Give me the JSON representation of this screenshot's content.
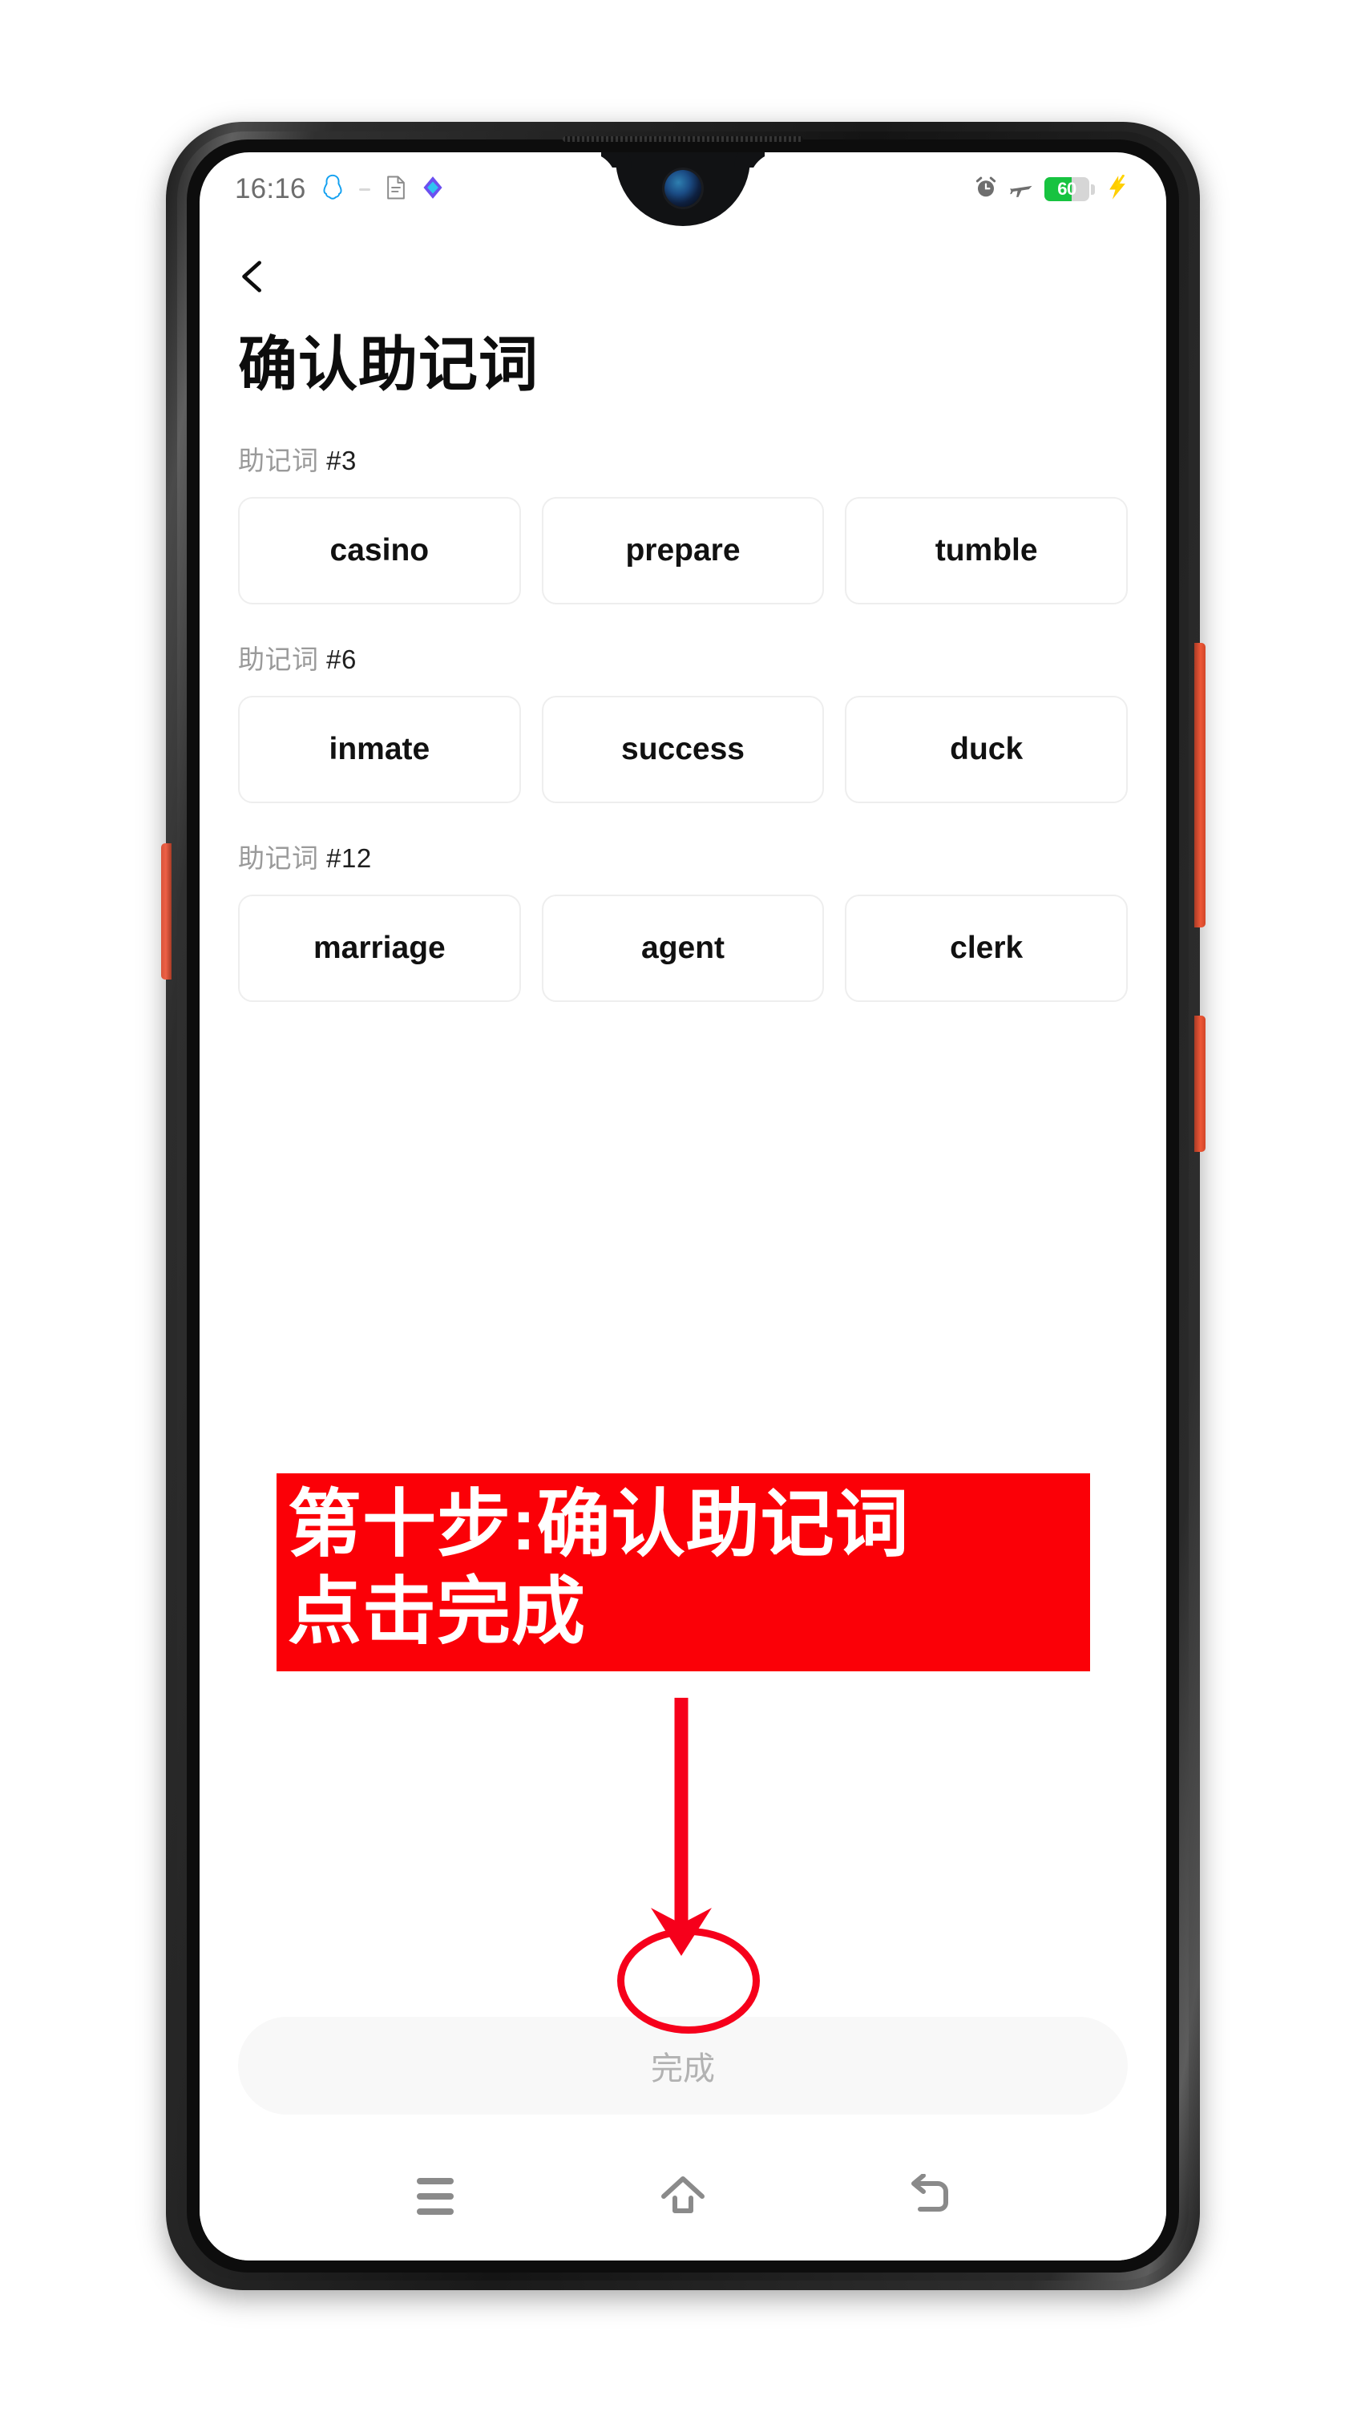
{
  "status_bar": {
    "time": "16:16",
    "left_icons": [
      "qq-penguin-icon",
      "document-icon",
      "diamond-app-icon"
    ],
    "right_icons": [
      "alarm-clock-icon",
      "airplane-mode-icon",
      "battery-icon",
      "charging-bolt-icon"
    ],
    "battery_percent": "60",
    "battery_level": 60,
    "battery_color": "#17c340"
  },
  "header": {
    "back_icon": "chevron-left-icon",
    "title": "确认助记词"
  },
  "groups": [
    {
      "label_text": "助记词 ",
      "index_text": "#3",
      "words": [
        "casino",
        "prepare",
        "tumble"
      ]
    },
    {
      "label_text": "助记词 ",
      "index_text": "#6",
      "words": [
        "inmate",
        "success",
        "duck"
      ]
    },
    {
      "label_text": "助记词 ",
      "index_text": "#12",
      "words": [
        "marriage",
        "agent",
        "clerk"
      ]
    }
  ],
  "done_button": {
    "label": "完成",
    "enabled": false,
    "background": "#f8f8f8",
    "text_color": "#b2b2b2"
  },
  "nav_bar": {
    "recents_icon": "menu-icon",
    "home_icon": "home-icon",
    "back_icon": "back-arrow-icon"
  },
  "annotation": {
    "line1": "第十步:确认助记词",
    "line2": "点击完成",
    "background": "#fb0007",
    "text_color": "#ffffff",
    "arrow_color": "#f6001b",
    "highlight_color": "#f6001b"
  }
}
